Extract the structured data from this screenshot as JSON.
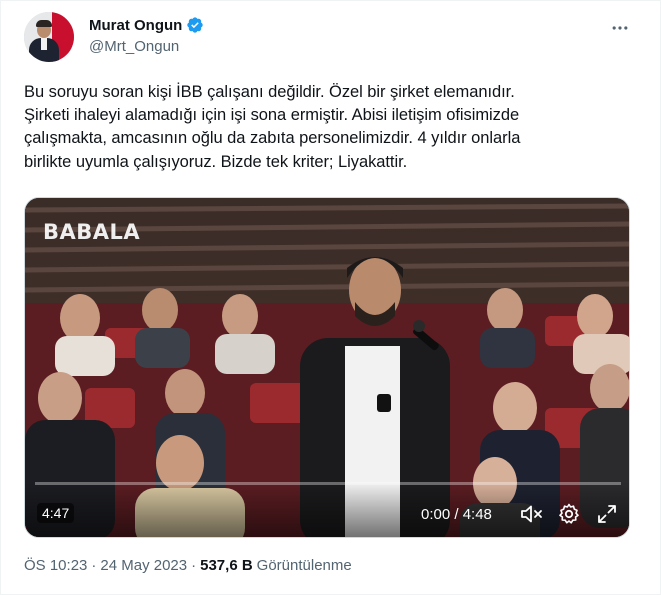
{
  "author": {
    "display_name": "Murat Ongun",
    "handle": "@Mrt_Ongun",
    "verified": true
  },
  "tweet": {
    "text": "Bu soruyu soran kişi İBB çalışanı değildir. Özel bir şirket elemanıdır.\nŞirketi ihaleyi alamadığı için işi sona ermiştir. Abisi iletişim ofisimizde\nçalışmakta, amcasının oğlu da zabıta personelimizdir. 4 yıldır onlarla\nbirlikte uyumla çalışıyoruz. Bizde tek kriter; Liyakattir."
  },
  "media": {
    "watermark": "BABALA",
    "duration_badge": "4:47",
    "time_display": "0:00 / 4:48",
    "progress": 0.0
  },
  "meta": {
    "time": "ÖS 10:23",
    "separator": "·",
    "date": "24 May 2023",
    "separator2": "·",
    "views_count": "537,6 B",
    "views_label": "Görüntülenme"
  },
  "colors": {
    "accent": "#1d9bf0",
    "secondary_text": "#536471",
    "primary_text": "#0f1419"
  },
  "icons": {
    "verified": "verified-badge-icon",
    "more": "more-horizontal-icon",
    "mute": "volume-muted-icon",
    "settings": "gear-icon",
    "fullscreen": "fullscreen-icon"
  }
}
